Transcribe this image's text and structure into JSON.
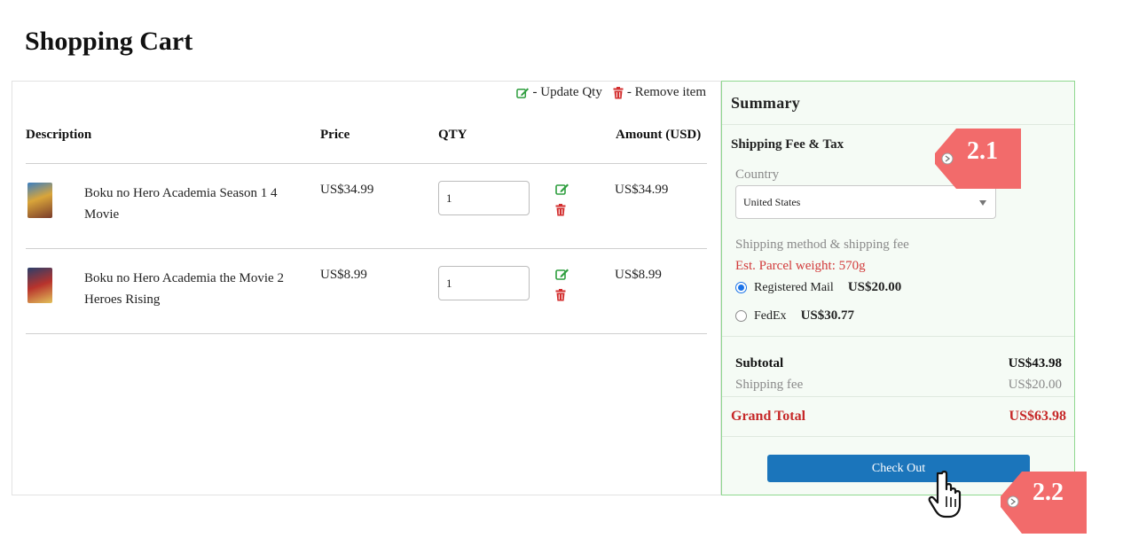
{
  "page": {
    "title": "Shopping Cart"
  },
  "legend": {
    "update_label": "- Update Qty",
    "remove_label": "- Remove item"
  },
  "table": {
    "headers": {
      "description": "Description",
      "price": "Price",
      "qty": "QTY",
      "amount": "Amount (USD)"
    },
    "rows": [
      {
        "description": "Boku no Hero Academia Season 1 4 Movie",
        "price": "US$34.99",
        "qty": "1",
        "amount": "US$34.99"
      },
      {
        "description": "Boku no Hero Academia the Movie 2 Heroes Rising",
        "price": "US$8.99",
        "qty": "1",
        "amount": "US$8.99"
      }
    ]
  },
  "summary": {
    "title": "Summary",
    "shipping_heading": "Shipping Fee & Tax",
    "country_label": "Country",
    "country_value": "United States",
    "method_label": "Shipping method & shipping fee",
    "parcel_weight": "Est. Parcel weight: 570g",
    "options": [
      {
        "name": "Registered Mail",
        "fee": "US$20.00",
        "selected": true
      },
      {
        "name": "FedEx",
        "fee": "US$30.77",
        "selected": false
      }
    ],
    "subtotal_label": "Subtotal",
    "subtotal_value": "US$43.98",
    "shipping_fee_label": "Shipping fee",
    "shipping_fee_value": "US$20.00",
    "grand_total_label": "Grand Total",
    "grand_total_value": "US$63.98",
    "checkout_label": "Check Out"
  },
  "callouts": {
    "first": "2.1",
    "second": "2.2"
  },
  "colors": {
    "accent_green": "#2e9e3e",
    "danger_red": "#d32f2f",
    "checkout_blue": "#1b75bb",
    "callout": "#f26b6b",
    "summary_border": "#8fd88f"
  }
}
